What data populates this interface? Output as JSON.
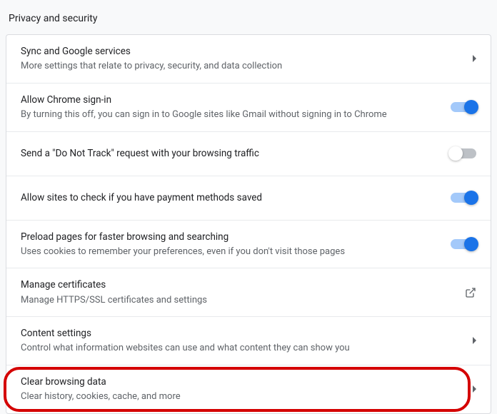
{
  "section_title": "Privacy and security",
  "rows": [
    {
      "title": "Sync and Google services",
      "sub": "More settings that relate to privacy, security, and data collection",
      "action": "chevron"
    },
    {
      "title": "Allow Chrome sign-in",
      "sub": "By turning this off, you can sign in to Google sites like Gmail without signing in to Chrome",
      "action": "toggle-on"
    },
    {
      "title": "Send a \"Do Not Track\" request with your browsing traffic",
      "sub": "",
      "action": "toggle-off"
    },
    {
      "title": "Allow sites to check if you have payment methods saved",
      "sub": "",
      "action": "toggle-on"
    },
    {
      "title": "Preload pages for faster browsing and searching",
      "sub": "Uses cookies to remember your preferences, even if you don't visit those pages",
      "action": "toggle-on"
    },
    {
      "title": "Manage certificates",
      "sub": "Manage HTTPS/SSL certificates and settings",
      "action": "external"
    },
    {
      "title": "Content settings",
      "sub": "Control what information websites can use and what content they can show you",
      "action": "chevron"
    },
    {
      "title": "Clear browsing data",
      "sub": "Clear history, cookies, cache, and more",
      "action": "chevron",
      "highlighted": true
    }
  ]
}
